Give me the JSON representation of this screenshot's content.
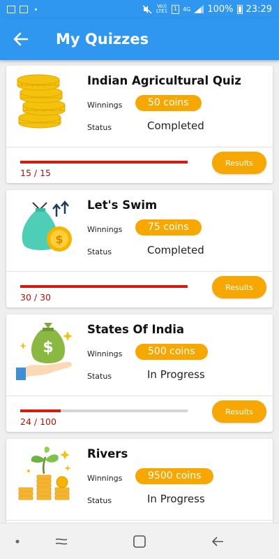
{
  "status_bar": {
    "volte": "Vo)) LTE1",
    "sim": "1",
    "network": "4G",
    "battery": "100%",
    "time": "23:29"
  },
  "header": {
    "title": "My Quizzes",
    "back_icon": "arrow-left-icon"
  },
  "labels": {
    "winnings": "Winnings",
    "status": "Status",
    "results": "Results"
  },
  "quizzes": [
    {
      "title": "Indian Agricultural Quiz",
      "icon": "gold-coins-stack-icon",
      "winnings": "50 coins",
      "status": "Completed",
      "progress_text": "15 / 15",
      "progress": 1.0
    },
    {
      "title": "Let's Swim",
      "icon": "money-bag-icon",
      "winnings": "75 coins",
      "status": "Completed",
      "progress_text": "30 / 30",
      "progress": 1.0
    },
    {
      "title": "States Of India",
      "icon": "money-hand-icon",
      "winnings": "500 coins",
      "status": "In Progress",
      "progress_text": "24 / 100",
      "progress": 0.24
    },
    {
      "title": "Rivers",
      "icon": "money-plant-icon",
      "winnings": "9500 coins",
      "status": "In Progress",
      "progress_text": "",
      "progress": 0
    }
  ],
  "colors": {
    "primary": "#2f97f0",
    "accent": "#f7a800",
    "progress": "#d7190f",
    "progress_text": "#b01208"
  }
}
